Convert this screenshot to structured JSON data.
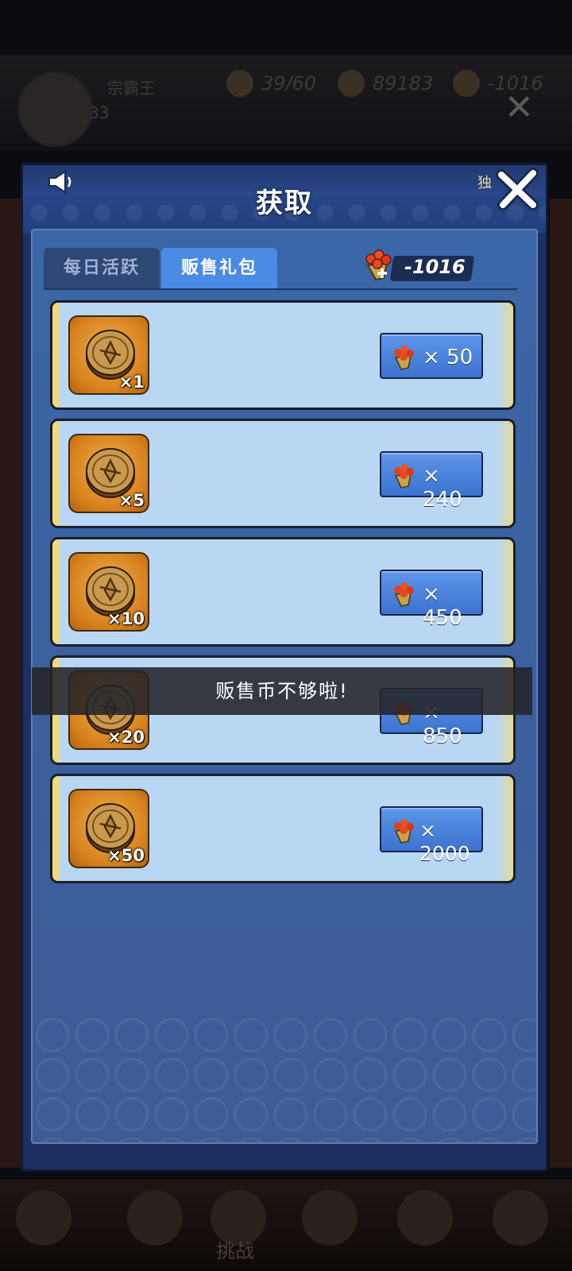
{
  "background": {
    "player_name": "宗霸王",
    "player_level": "33",
    "resources": [
      "39/60",
      "89183",
      "-1016"
    ],
    "bottom_tab_label": "挑战"
  },
  "modal": {
    "title": "获取",
    "corner_text": "独",
    "tabs": [
      {
        "label": "每日活跃",
        "active": false
      },
      {
        "label": "贩售礼包",
        "active": true
      }
    ],
    "currency_value": "-1016",
    "items": [
      {
        "qty": "×1",
        "price": "× 50"
      },
      {
        "qty": "×5",
        "price": "× 240"
      },
      {
        "qty": "×10",
        "price": "× 450"
      },
      {
        "qty": "×20",
        "price": "× 850"
      },
      {
        "qty": "×50",
        "price": "× 2000"
      }
    ]
  },
  "toast": {
    "message": "贩售币不够啦!"
  },
  "colors": {
    "modal_bg": "#1d2f5e",
    "tab_active": "#4a8be5",
    "row_bg": "#b9d7f2",
    "row_accent": "#f2d97a",
    "price_button": "#4a84dd"
  },
  "icons": {
    "speaker": "speaker-icon",
    "close": "close-icon",
    "currency": "sale-currency-icon",
    "item": "gold-coin-icon"
  }
}
